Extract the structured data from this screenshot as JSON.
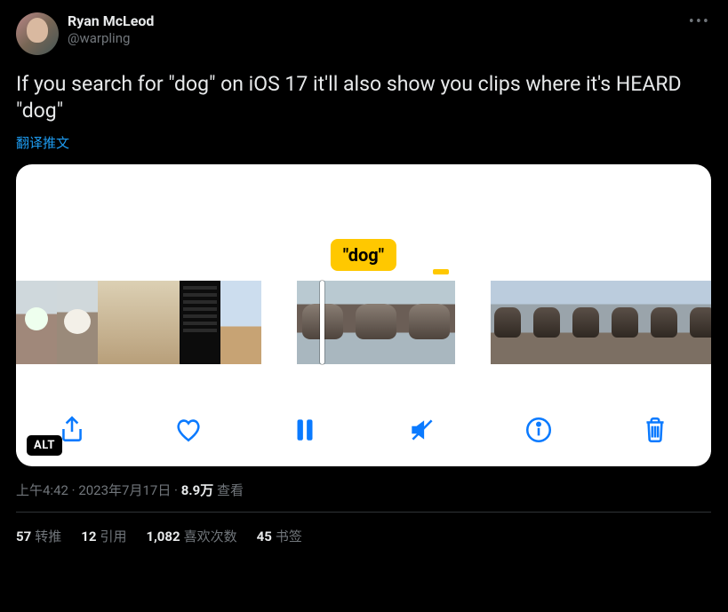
{
  "author": {
    "display_name": "Ryan McLeod",
    "handle": "@warpling"
  },
  "body": "If you search for \"dog\" on iOS 17 it'll also show you clips where it's HEARD \"dog\"",
  "translate_label": "翻译推文",
  "media": {
    "pill_text": "\"dog\"",
    "alt_badge": "ALT"
  },
  "meta": {
    "time": "上午4:42",
    "date": "2023年7月17日",
    "views_num": "8.9万",
    "views_label": "查看",
    "sep": " · "
  },
  "stats": {
    "retweets_num": "57",
    "retweets_label": "转推",
    "quotes_num": "12",
    "quotes_label": "引用",
    "likes_num": "1,082",
    "likes_label": "喜欢次数",
    "bookmarks_num": "45",
    "bookmarks_label": "书签"
  }
}
